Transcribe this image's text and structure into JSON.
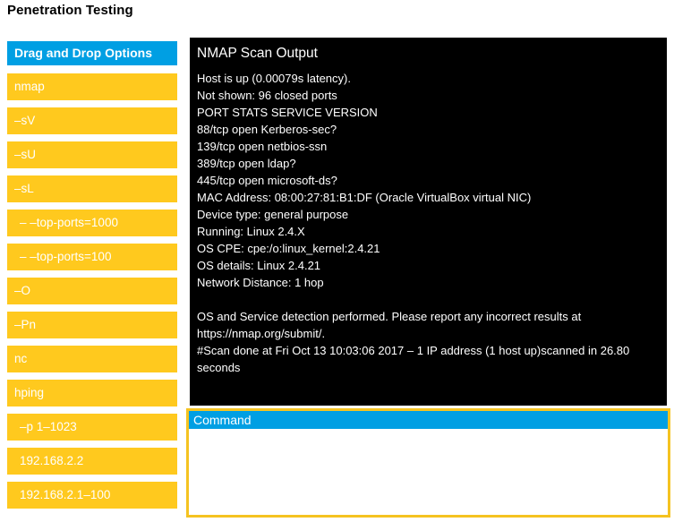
{
  "page_title": "Penetration Testing",
  "colors": {
    "accent_blue": "#009fe3",
    "chip_yellow": "#ffc91e",
    "border_gold": "#f5c321",
    "terminal_bg": "#000000",
    "terminal_fg": "#ffffff"
  },
  "sidebar": {
    "header": "Drag and Drop Options",
    "items": [
      {
        "label": "nmap",
        "indent": false
      },
      {
        "label": "–sV",
        "indent": false
      },
      {
        "label": "–sU",
        "indent": false
      },
      {
        "label": "–sL",
        "indent": false
      },
      {
        "label": "– –top-ports=1000",
        "indent": true
      },
      {
        "label": "– –top-ports=100",
        "indent": true
      },
      {
        "label": "–O",
        "indent": false
      },
      {
        "label": "–Pn",
        "indent": false
      },
      {
        "label": "nc",
        "indent": false
      },
      {
        "label": "hping",
        "indent": false
      },
      {
        "label": "–p 1–1023",
        "indent": true
      },
      {
        "label": "192.168.2.2",
        "indent": true
      },
      {
        "label": "192.168.2.1–100",
        "indent": true
      }
    ]
  },
  "terminal": {
    "title": "NMAP Scan Output",
    "lines": [
      "Host is up (0.00079s latency).",
      "Not shown: 96 closed ports",
      "PORT STATS SERVICE VERSION",
      "88/tcp open Kerberos-sec?",
      "139/tcp open netbios-ssn",
      "389/tcp open ldap?",
      "445/tcp open microsoft-ds?",
      "MAC Address: 08:00:27:81:B1:DF (Oracle VirtualBox virtual NIC)",
      "Device type: general purpose",
      "Running: Linux 2.4.X",
      "OS CPE: cpe:/o:linux_kernel:2.4.21",
      "OS details: Linux 2.4.21",
      "Network Distance: 1 hop",
      "",
      "OS and Service detection performed. Please report any incorrect results at https://nmap.org/submit/.",
      "#Scan done at Fri Oct 13 10:03:06 2017 – 1 IP address (1 host up)scanned in 26.80 seconds"
    ]
  },
  "command": {
    "header": "Command",
    "value": "",
    "placeholder": ""
  }
}
